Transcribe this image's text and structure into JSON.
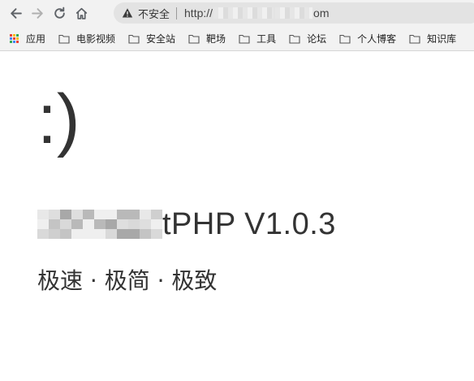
{
  "browser": {
    "insecure_label": "不安全",
    "url_prefix": "http://",
    "url_suffix": "om",
    "bookmarks": [
      {
        "label": "应用",
        "icon": "apps-grid-icon"
      },
      {
        "label": "电影视频",
        "icon": "folder-icon"
      },
      {
        "label": "安全站",
        "icon": "folder-icon"
      },
      {
        "label": "靶场",
        "icon": "folder-icon"
      },
      {
        "label": "工具",
        "icon": "folder-icon"
      },
      {
        "label": "论坛",
        "icon": "folder-icon"
      },
      {
        "label": "个人博客",
        "icon": "folder-icon"
      },
      {
        "label": "知识库",
        "icon": "folder-icon"
      }
    ]
  },
  "page": {
    "emoticon": ":)",
    "title_suffix": "tPHP V1.0.3",
    "tagline": "极速 · 极简 · 极致"
  },
  "colors": {
    "text": "#333333",
    "toolbar_bg": "#f2f2f2",
    "omnibox_bg": "#e3e3e3"
  }
}
